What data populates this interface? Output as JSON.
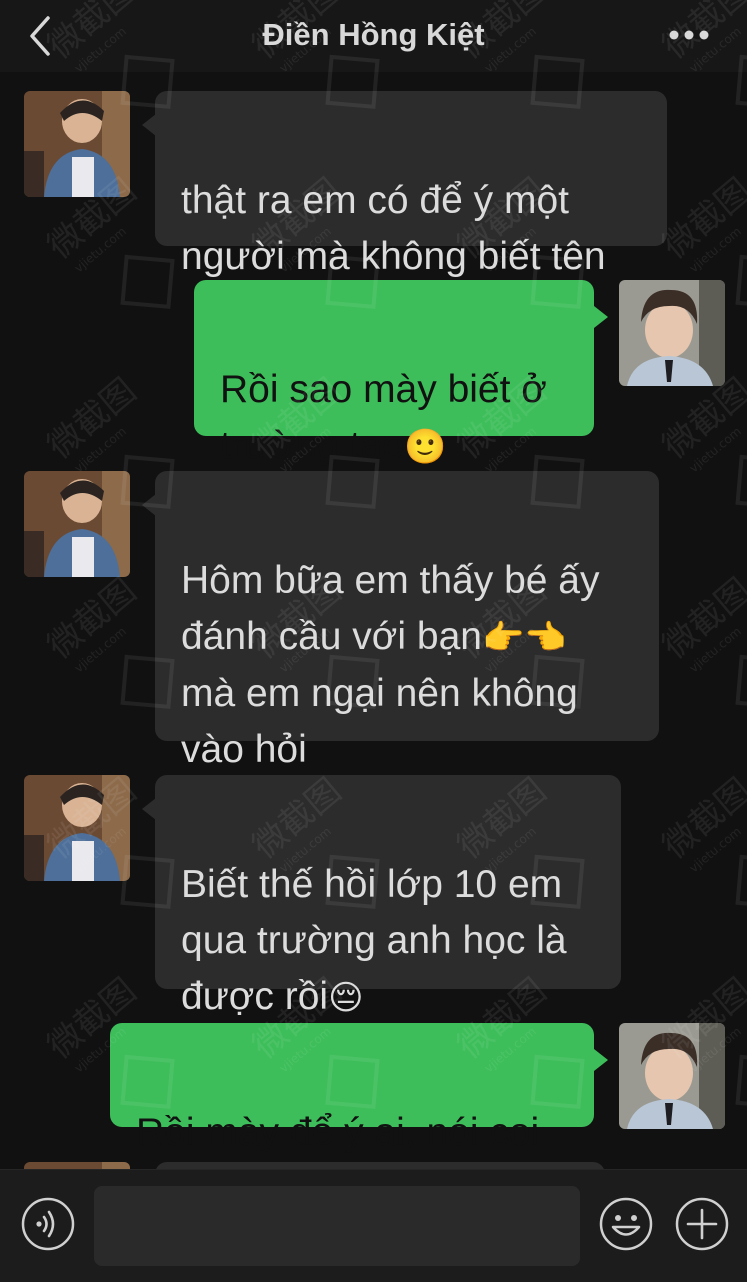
{
  "header": {
    "title": "Điền Hồng Kiệt",
    "back_icon": "chevron-left-icon",
    "more_icon": "ellipsis-icon"
  },
  "messages": [
    {
      "side": "received",
      "text": "thật ra em có để ý một\nngười mà không biết tên"
    },
    {
      "side": "sent",
      "text": "Rồi sao mày biết ở\ntrường tao",
      "emoji": "🙂"
    },
    {
      "side": "received",
      "text": "Hôm bữa em thấy bé ấy\nđánh cầu với bạn",
      "emoji": "👉👈",
      "text_after": "\nmà em ngại nên không\nvào hỏi"
    },
    {
      "side": "received",
      "text": "Biết thế hồi lớp 10 em\nqua trường anh học là\nđược rồi",
      "emoji": "😔"
    },
    {
      "side": "sent",
      "text": "Rồi mày để ý ai, nói coi"
    }
  ],
  "watermark": {
    "text": "微截图",
    "url": "vjietu.com"
  },
  "input_bar": {
    "voice_icon": "voice-icon",
    "input_value": "",
    "emoji_icon": "smiley-icon",
    "add_icon": "plus-icon"
  },
  "colors": {
    "background": "#111111",
    "header": "#171717",
    "received_bubble": "#2c2c2c",
    "sent_bubble": "#3dbe5a"
  }
}
